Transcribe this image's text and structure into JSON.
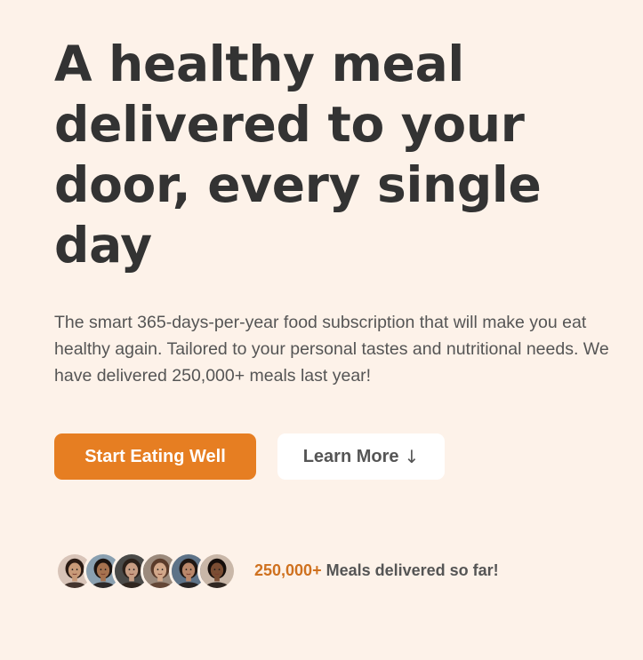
{
  "hero": {
    "title": "A healthy meal delivered to your door, every single day",
    "description": "The smart 365-days-per-year food subscription that will make you eat healthy again. Tailored to your personal tastes and nutritional needs. We have delivered 250,000+ meals last year!",
    "primary_button_label": "Start Eating Well",
    "secondary_button_label": "Learn More",
    "secondary_button_arrow": "↓"
  },
  "delivered": {
    "count": "250,000+",
    "text": " Meals delivered so far!",
    "avatars": [
      {
        "name": "customer-1",
        "skin": "#c89a78",
        "hair": "#2a1b14",
        "bg": "#d8c4b8"
      },
      {
        "name": "customer-2",
        "skin": "#a6724f",
        "hair": "#1c1410",
        "bg": "#8aa0b0"
      },
      {
        "name": "customer-3",
        "skin": "#c79d83",
        "hair": "#2b2019",
        "bg": "#4a4a48"
      },
      {
        "name": "customer-4",
        "skin": "#d2a88a",
        "hair": "#5a3b2a",
        "bg": "#9b8a7c"
      },
      {
        "name": "customer-5",
        "skin": "#b9876a",
        "hair": "#1e1612",
        "bg": "#5e7388"
      },
      {
        "name": "customer-6",
        "skin": "#7a4d33",
        "hair": "#150e0b",
        "bg": "#c9b7a8"
      }
    ]
  },
  "colors": {
    "background": "#fdf2e9",
    "primary": "#e67e22",
    "accent_text": "#cf711f",
    "heading": "#333333",
    "body_text": "#555555"
  }
}
